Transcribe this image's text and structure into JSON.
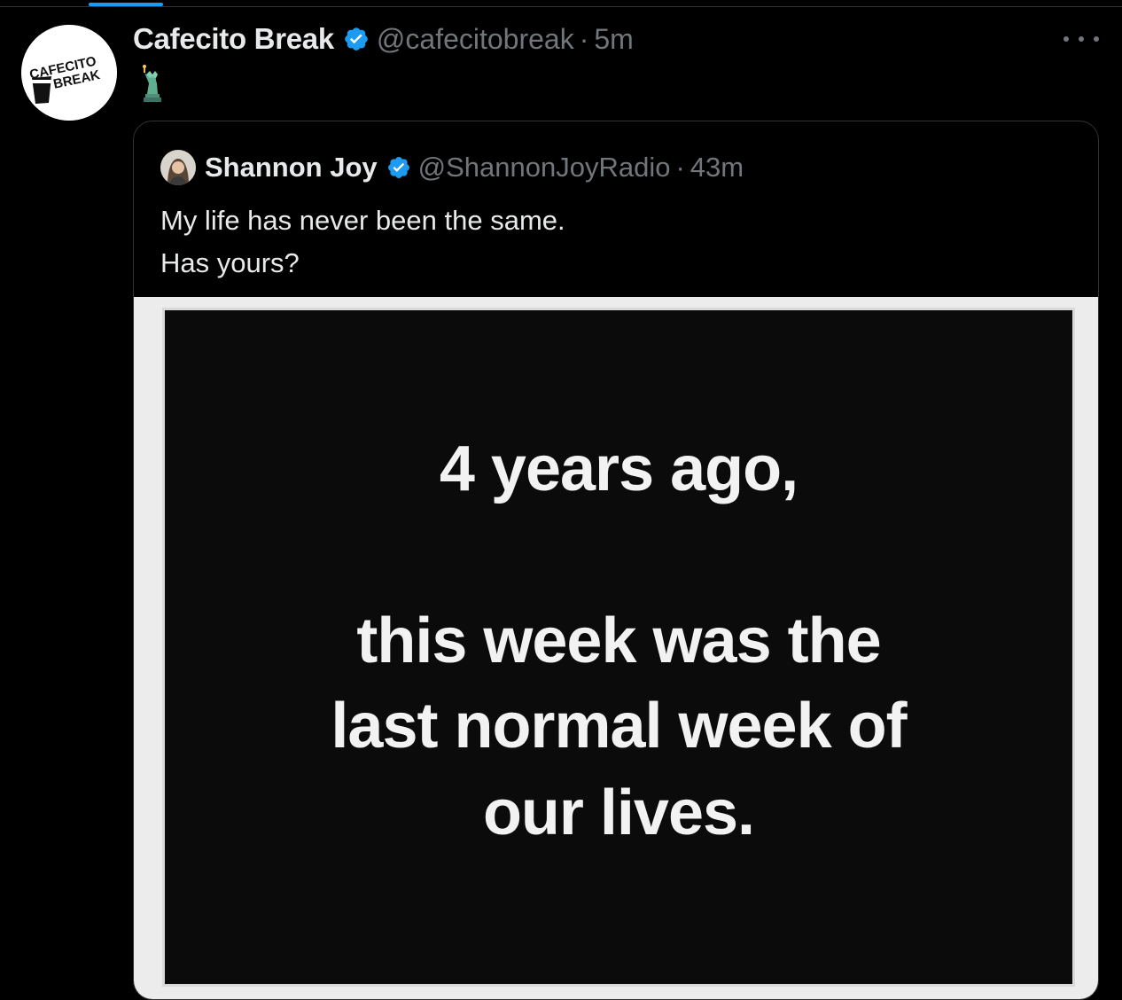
{
  "tweet": {
    "author_name": "Cafecito Break",
    "handle": "@cafecitobreak",
    "separator": "·",
    "time": "5m",
    "body_emoji": "statue-of-liberty",
    "avatar_text": [
      "CAFECITO",
      "BREAK"
    ],
    "verified_color": "#1d9bf0"
  },
  "quote": {
    "author_name": "Shannon Joy",
    "handle": "@ShannonJoyRadio",
    "separator": "·",
    "time": "43m",
    "text_lines": [
      "My life has never been the same.",
      "Has yours?"
    ]
  },
  "media": {
    "lines": [
      "4 years ago,",
      "this week was the",
      "last normal week of",
      "our lives."
    ]
  },
  "icons": {
    "more": "more-horizontal-icon",
    "verified": "verified-badge-icon"
  }
}
